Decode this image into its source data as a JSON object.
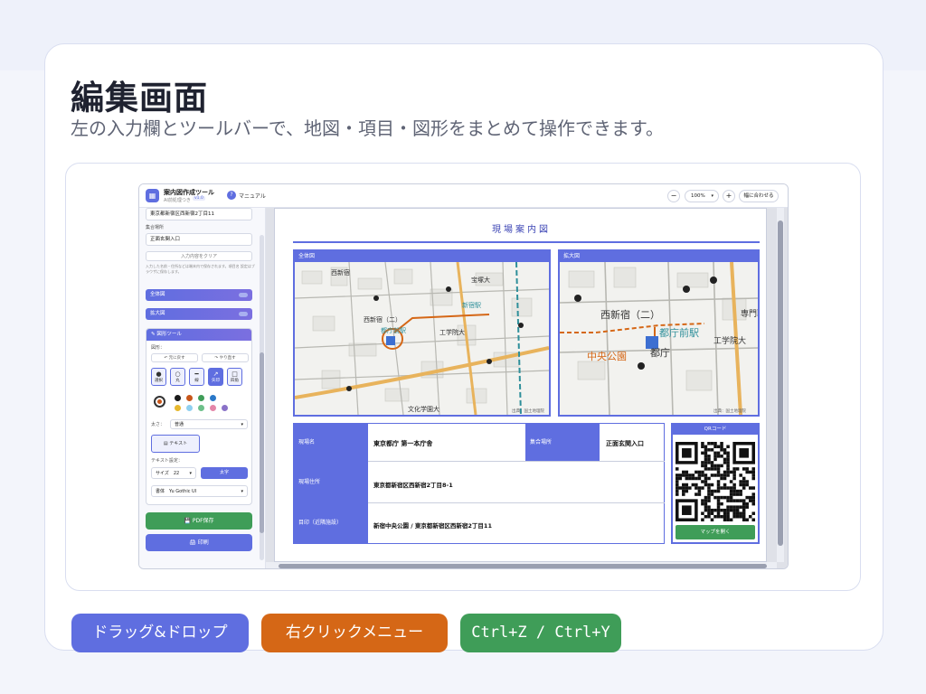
{
  "page": {
    "title": "編集画面",
    "subtitle": "左の入力欄とツールバーで、地図・項目・図形をまとめて操作できます。"
  },
  "app": {
    "name": "案内図作成ツール",
    "sub": "AI前処理つき",
    "version": "v1.0",
    "manual_label": "マニュアル",
    "zoom_minus": "−",
    "zoom_value": "100%",
    "zoom_plus": "+",
    "fit_label": "幅に合わせる"
  },
  "sidebar": {
    "address_value": "東京都新宿区西新宿2丁目11",
    "meeting_label": "集合場所",
    "meeting_value": "正面玄関入口",
    "clear_label": "入力内容をクリア",
    "note": "入力した名前・住所などは端末内で保存されます。項目名 設定はブラウザに保存します。",
    "section_overall": "全体図",
    "section_zoom": "拡大図",
    "shape_tool_title": "図形ツール",
    "shape_label": "図形：",
    "undo_label": "元に戻す",
    "redo_label": "やり直す",
    "tools": [
      {
        "icon": "●",
        "label": "選択"
      },
      {
        "icon": "○",
        "label": "丸"
      },
      {
        "icon": "━",
        "label": "線"
      },
      {
        "icon": "↗",
        "label": "矢印"
      },
      {
        "icon": "□",
        "label": "四角"
      }
    ],
    "colors": [
      "#1a1a1a",
      "#c8561a",
      "#3f9d58",
      "#2a78c8",
      "#e6b82e",
      "#8fd0f0",
      "#6dc08a",
      "#e486a8",
      "#8a72c8"
    ],
    "thickness_label": "太さ：",
    "thickness_value": "普通",
    "text_button": "テキスト",
    "text_settings_label": "テキスト設定：",
    "size_label": "サイズ",
    "size_value": "22",
    "bold_label": "太字",
    "font_label": "書体",
    "font_value": "Yu Gothic UI",
    "pdf_label": "PDF保存",
    "print_label": "印刷"
  },
  "document": {
    "title": "現場案内図",
    "overall_map": {
      "label": "全体図",
      "place_labels": [
        "西新宿",
        "西新宿（二）",
        "都庁前駅",
        "新宿駅",
        "工学院大",
        "文化学園大",
        "宝塚大"
      ],
      "credit": "出典：国土地理院"
    },
    "zoom_map": {
      "label": "拡大図",
      "place_labels": [
        "西新宿（二）",
        "都庁前駅",
        "都庁",
        "中央公園",
        "工学院大",
        "専門職大"
      ],
      "credit": "出典：国土地理院"
    },
    "table": {
      "site_name_label": "現場名",
      "site_name_value": "東京都庁 第一本庁舎",
      "meeting_label": "集合場所",
      "meeting_value": "正面玄関入口",
      "address_label": "現場住所",
      "address_value": "東京都新宿区西新宿2丁目8-1",
      "landmark_label": "目印（近隣施設）",
      "landmark_value": "新宿中央公園 / 東京都新宿区西新宿2丁目11"
    },
    "qr": {
      "label": "QRコード",
      "button": "マップを開く"
    }
  },
  "features": [
    {
      "label": "ドラッグ&ドロップ",
      "color": "#5f6ee0"
    },
    {
      "label": "右クリックメニュー",
      "color": "#d56716"
    },
    {
      "label": "Ctrl+Z / Ctrl+Y",
      "color": "#3f9d58"
    }
  ]
}
